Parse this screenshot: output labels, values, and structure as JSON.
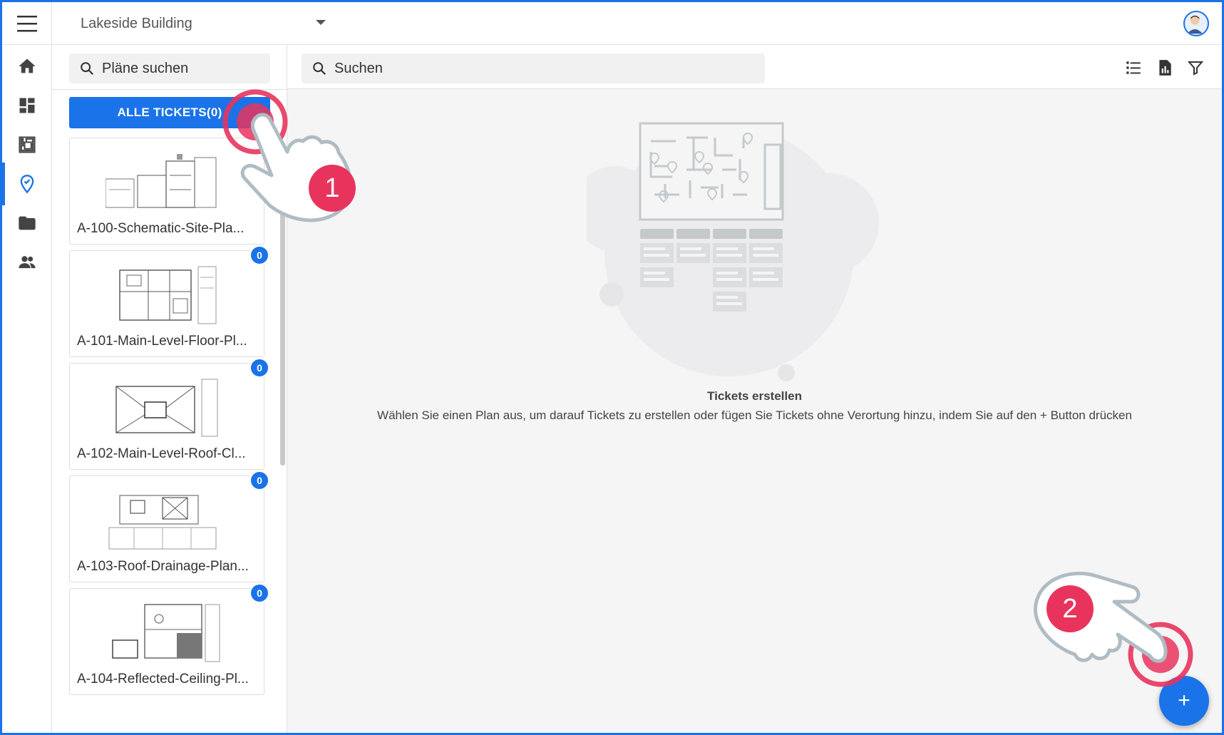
{
  "header": {
    "project_name": "Lakeside Building"
  },
  "rail": {
    "items": [
      {
        "name": "home-icon"
      },
      {
        "name": "dashboard-icon"
      },
      {
        "name": "plans-icon"
      },
      {
        "name": "tickets-icon",
        "active": true
      },
      {
        "name": "folder-icon"
      },
      {
        "name": "people-icon"
      }
    ]
  },
  "plans": {
    "search_placeholder": "Pläne suchen",
    "all_tickets_label": "ALLE TICKETS(0)",
    "items": [
      {
        "name": "A-100-Schematic-Site-Pla...",
        "count": ""
      },
      {
        "name": "A-101-Main-Level-Floor-Pl...",
        "count": "0"
      },
      {
        "name": "A-102-Main-Level-Roof-Cl...",
        "count": "0"
      },
      {
        "name": "A-103-Roof-Drainage-Plan...",
        "count": "0"
      },
      {
        "name": "A-104-Reflected-Ceiling-Pl...",
        "count": "0"
      }
    ]
  },
  "main": {
    "search_placeholder": "Suchen",
    "empty_title": "Tickets erstellen",
    "empty_description": "Wählen Sie einen Plan aus, um darauf Tickets zu erstellen oder fügen Sie Tickets ohne Verortung hinzu, indem Sie auf den + Button drücken",
    "fab_label": "+"
  },
  "annotations": {
    "step1": "1",
    "step2": "2"
  },
  "colors": {
    "accent": "#1a73e8",
    "highlight": "#e8345d"
  }
}
